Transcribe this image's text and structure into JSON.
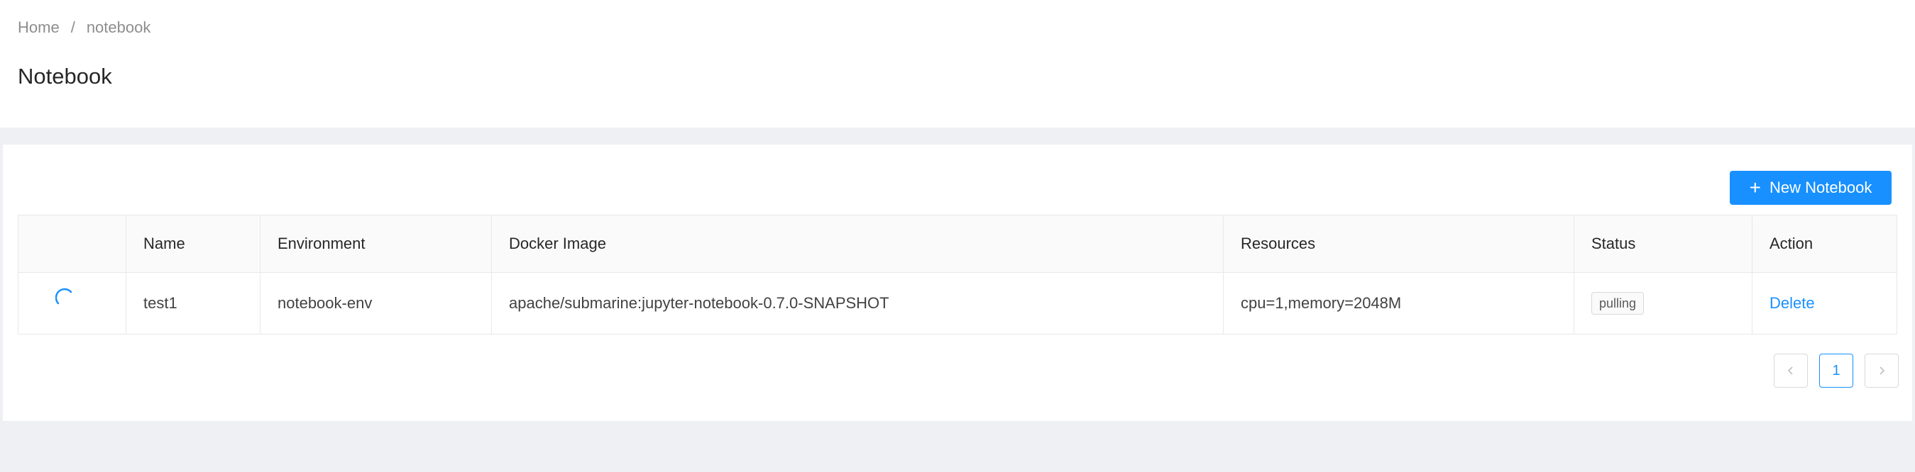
{
  "breadcrumb": {
    "home": "Home",
    "separator": "/",
    "current": "notebook"
  },
  "page": {
    "title": "Notebook"
  },
  "toolbar": {
    "new_button_label": "New Notebook",
    "new_button_icon": "plus-icon"
  },
  "table": {
    "columns": [
      "",
      "Name",
      "Environment",
      "Docker Image",
      "Resources",
      "Status",
      "Action"
    ],
    "rows": [
      {
        "loading_icon": "spinner-icon",
        "name": "test1",
        "environment": "notebook-env",
        "docker_image": "apache/submarine:jupyter-notebook-0.7.0-SNAPSHOT",
        "resources": "cpu=1,memory=2048M",
        "status": "pulling",
        "action": "Delete"
      }
    ]
  },
  "pagination": {
    "prev_icon": "chevron-left-icon",
    "current_page": "1",
    "next_icon": "chevron-right-icon"
  },
  "colors": {
    "primary": "#1890ff",
    "page_background": "#eef0f4",
    "header_background": "#ffffff"
  }
}
